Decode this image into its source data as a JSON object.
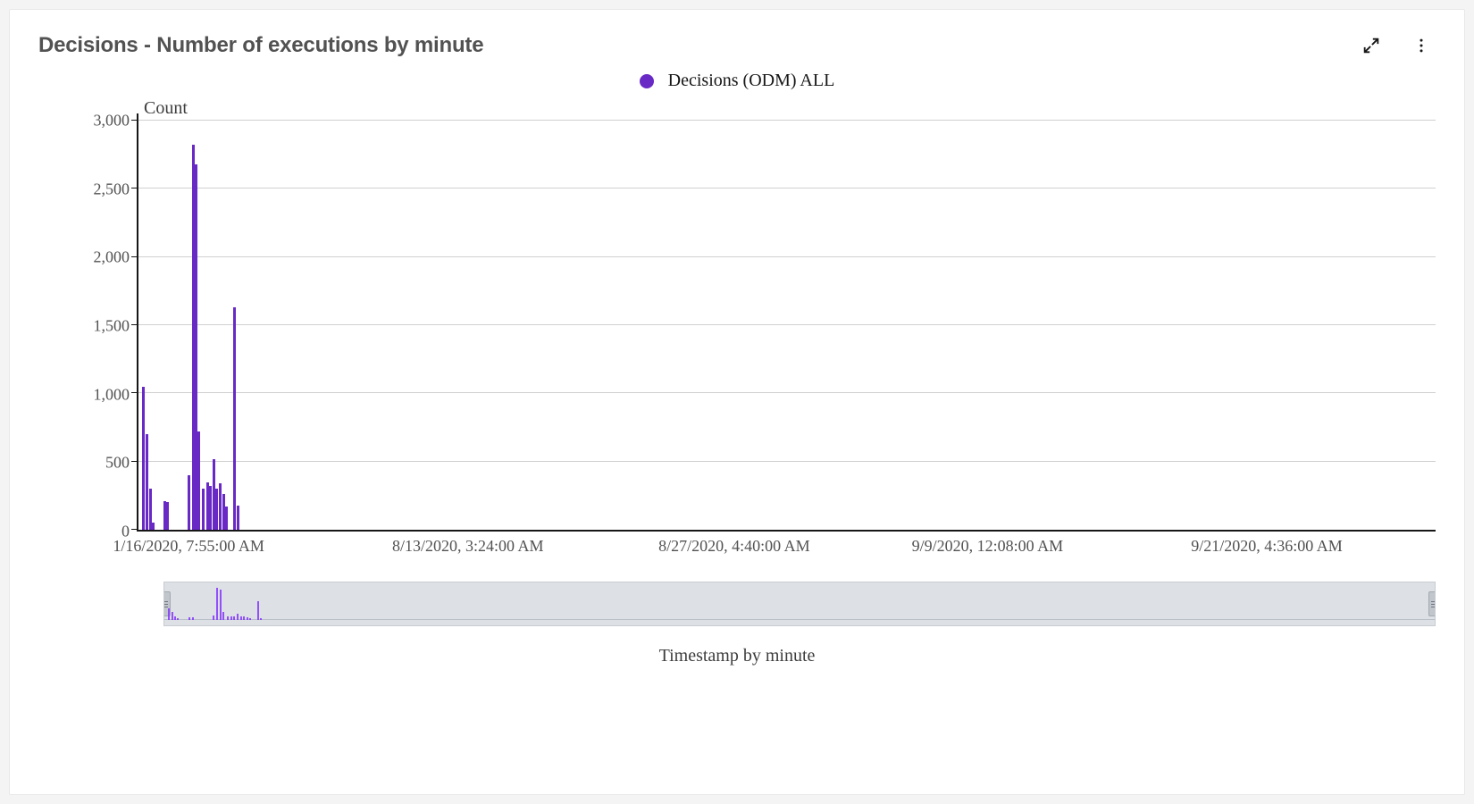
{
  "card": {
    "title": "Decisions - Number of executions by minute"
  },
  "legend": {
    "label": "Decisions (ODM) ALL",
    "color": "#6929c4"
  },
  "axes": {
    "y_title": "Count",
    "x_title": "Timestamp by minute",
    "y_ticks": [
      "0",
      "500",
      "1,000",
      "1,500",
      "2,000",
      "2,500",
      "3,000"
    ],
    "x_ticks": [
      "1/16/2020, 7:55:00 AM",
      "8/13/2020, 3:24:00 AM",
      "8/27/2020, 4:40:00 AM",
      "9/9/2020, 12:08:00 AM",
      "9/21/2020, 4:36:00 AM"
    ],
    "x_tick_positions_pct": [
      4.0,
      25.5,
      46.0,
      65.5,
      87.0
    ]
  },
  "chart_data": {
    "type": "bar",
    "title": "Decisions - Number of executions by minute",
    "xlabel": "Timestamp by minute",
    "ylabel": "Count",
    "ylim": [
      0,
      3000
    ],
    "series": [
      {
        "name": "Decisions (ODM) ALL",
        "color": "#6929c4",
        "points": [
          {
            "x_pct": 0.3,
            "value": 1050
          },
          {
            "x_pct": 0.55,
            "value": 700
          },
          {
            "x_pct": 0.8,
            "value": 300
          },
          {
            "x_pct": 1.0,
            "value": 50
          },
          {
            "x_pct": 1.9,
            "value": 210
          },
          {
            "x_pct": 2.15,
            "value": 200
          },
          {
            "x_pct": 3.8,
            "value": 400
          },
          {
            "x_pct": 4.1,
            "value": 2820
          },
          {
            "x_pct": 4.35,
            "value": 2680
          },
          {
            "x_pct": 4.55,
            "value": 720
          },
          {
            "x_pct": 4.9,
            "value": 300
          },
          {
            "x_pct": 5.2,
            "value": 350
          },
          {
            "x_pct": 5.45,
            "value": 320
          },
          {
            "x_pct": 5.7,
            "value": 520
          },
          {
            "x_pct": 5.95,
            "value": 300
          },
          {
            "x_pct": 6.2,
            "value": 340
          },
          {
            "x_pct": 6.45,
            "value": 260
          },
          {
            "x_pct": 6.65,
            "value": 170
          },
          {
            "x_pct": 7.3,
            "value": 1630
          },
          {
            "x_pct": 7.55,
            "value": 180
          }
        ]
      }
    ]
  }
}
